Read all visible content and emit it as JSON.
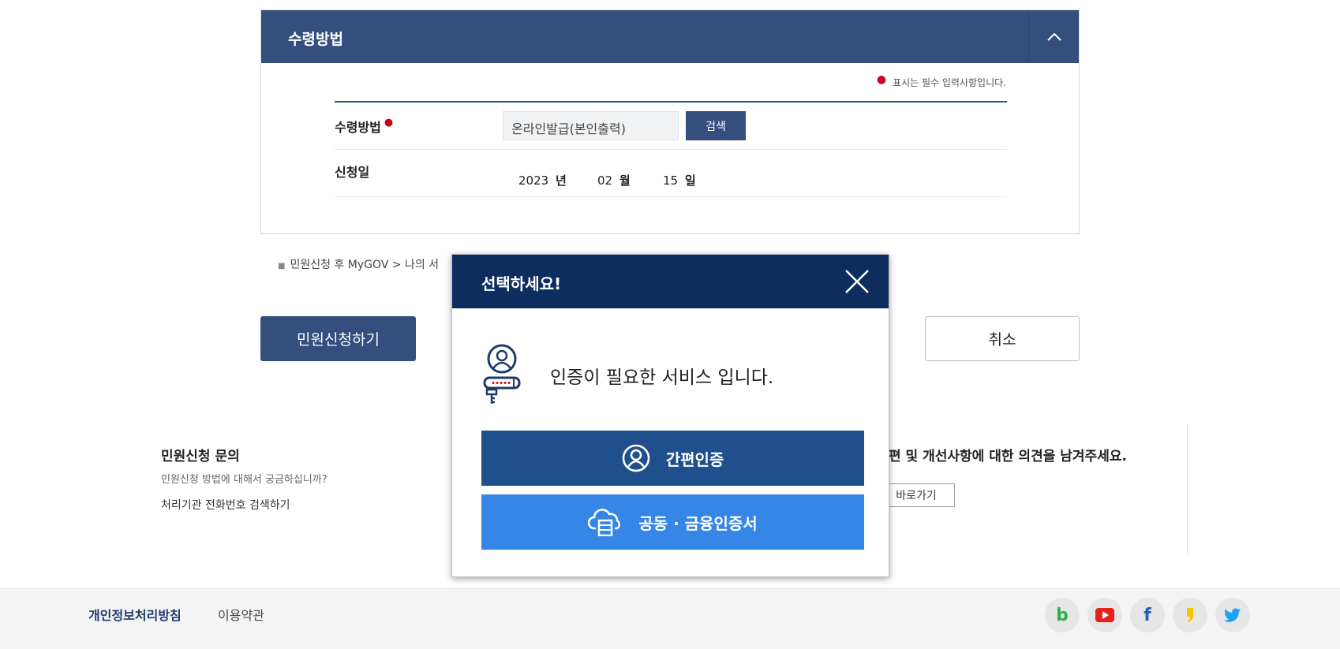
{
  "panel": {
    "title": "수령방법",
    "required_note": "표시는 필수 입력사항입니다.",
    "receive_label": "수령방법",
    "receive_value": "온라인발급(본인출력)",
    "search_label": "검색",
    "date_label": "신청일",
    "year": "2023",
    "year_unit": "년",
    "month": "02",
    "month_unit": "월",
    "day": "15",
    "day_unit": "일"
  },
  "note": {
    "text": "민원신청 후 MyGOV > 나의 서"
  },
  "actions": {
    "apply_label": "민원신청하기",
    "cancel_label": "취소"
  },
  "inquiry": {
    "title": "민원신청 문의",
    "desc": "민원신청 방법에 대해서 궁금하십니까?",
    "link": "처리기관 전화번호 검색하기"
  },
  "feedback": {
    "title": "편 및 개선사항에 대한 의견을 남겨주세요.",
    "button": "바로가기"
  },
  "footer": {
    "privacy": "개인정보처리방침",
    "terms": "이용약관",
    "social": [
      "blog-icon",
      "youtube-icon",
      "facebook-icon",
      "kakaostory-icon",
      "twitter-icon"
    ]
  },
  "modal": {
    "title": "선택하세요!",
    "message": "인증이 필요한 서비스 입니다.",
    "simple_auth": "간편인증",
    "cert_auth": "공동 · 금융인증서"
  },
  "colors": {
    "navy": "#344e7e",
    "modal_header": "#0d2d5e",
    "simple_btn": "#204f8e",
    "cert_btn": "#3586e6",
    "required_dot": "#d0021b"
  }
}
